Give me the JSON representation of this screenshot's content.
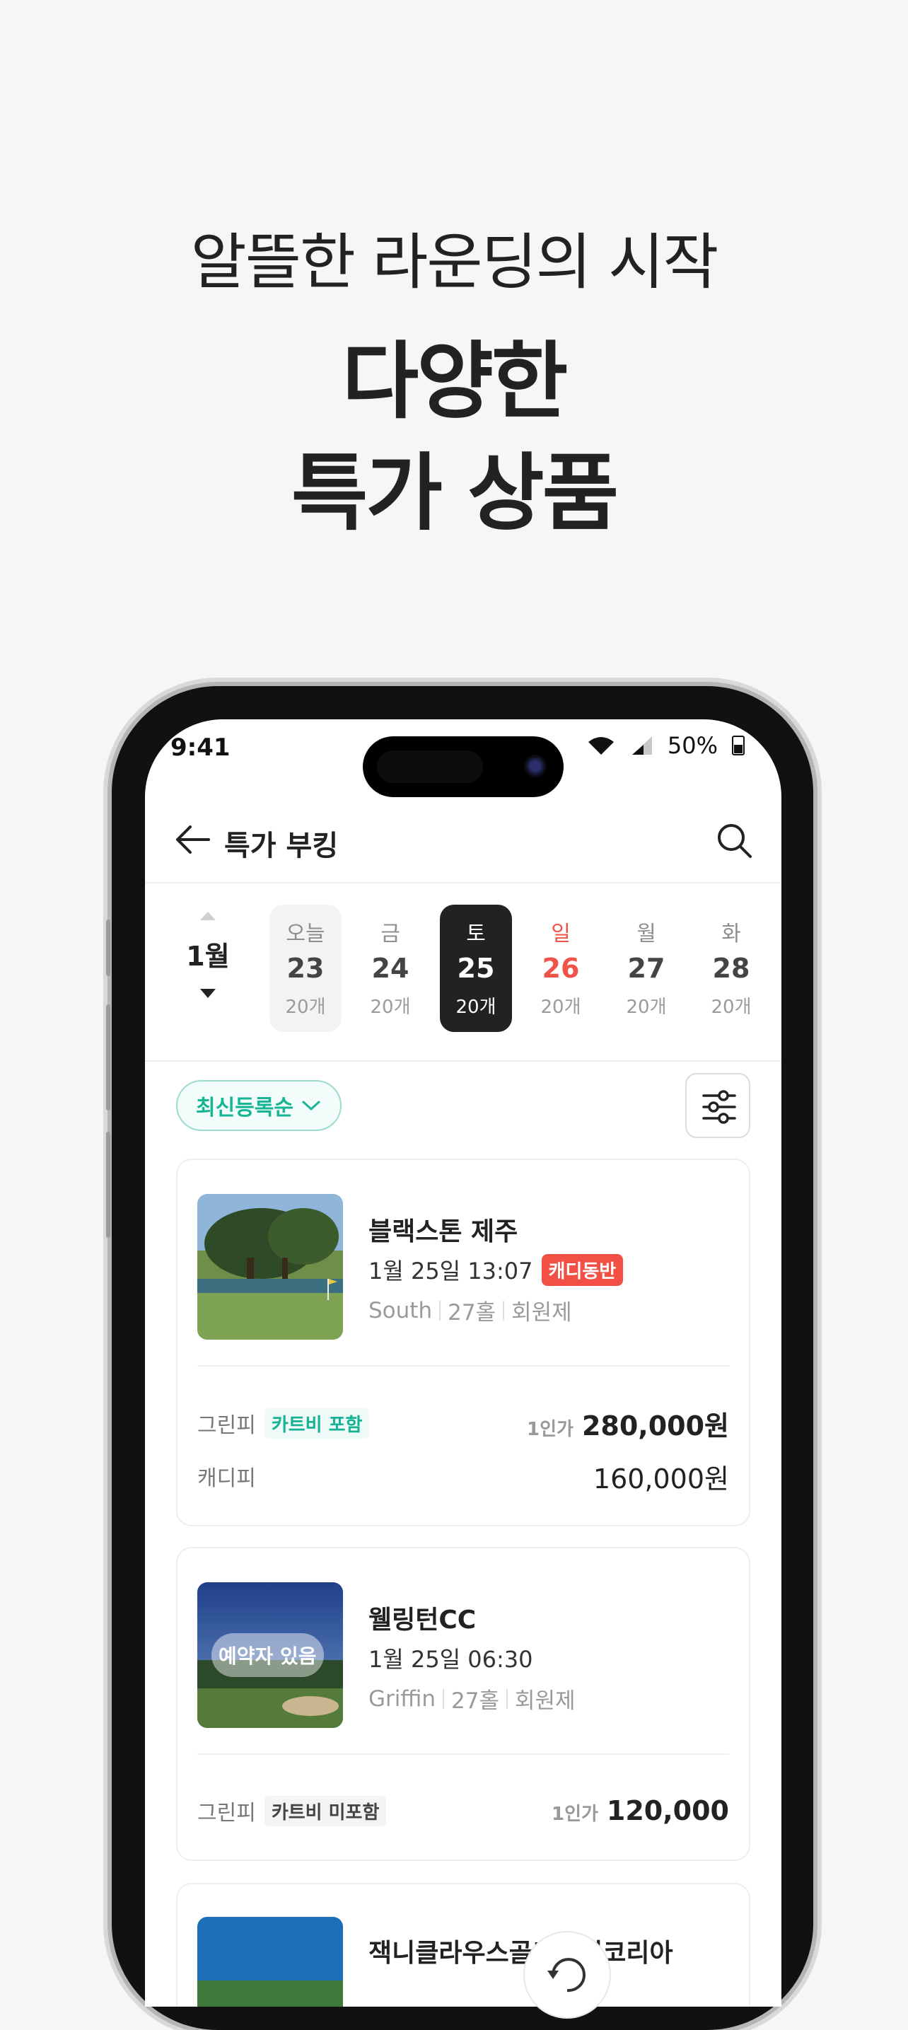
{
  "hero": {
    "subtitle": "알뜰한 라운딩의 시작",
    "title_line1": "다양한",
    "title_line2": "특가 상품"
  },
  "status_bar": {
    "time": "9:41",
    "battery": "50%"
  },
  "header": {
    "title": "특가 부킹",
    "back_icon": "arrow-left-icon",
    "search_icon": "search-icon"
  },
  "date_picker": {
    "month": "1월",
    "days": [
      {
        "dow": "오늘",
        "num": "23",
        "count": "20개",
        "state": "today"
      },
      {
        "dow": "금",
        "num": "24",
        "count": "20개",
        "state": "normal"
      },
      {
        "dow": "토",
        "num": "25",
        "count": "20개",
        "state": "selected"
      },
      {
        "dow": "일",
        "num": "26",
        "count": "20개",
        "state": "sunday"
      },
      {
        "dow": "월",
        "num": "27",
        "count": "20개",
        "state": "normal"
      },
      {
        "dow": "화",
        "num": "28",
        "count": "20개",
        "state": "normal"
      }
    ]
  },
  "sort": {
    "label": "최신등록순",
    "icon": "chevron-down-icon"
  },
  "filter": {
    "icon": "sliders-icon"
  },
  "colors": {
    "accent": "#17b596",
    "sunday": "#f0534a",
    "selected_bg": "#222222",
    "caddy_tag": "#f25045"
  },
  "cards": [
    {
      "name": "블랙스톤 제주",
      "datetime": "1월 25일 13:07",
      "tag": "캐디동반",
      "course": "South",
      "holes": "27홀",
      "membership": "회원제",
      "green_fee_label": "그린피",
      "cart_tag": "카트비 포함",
      "per_person": "1인가",
      "green_fee": "280,000원",
      "caddy_fee_label": "캐디피",
      "caddy_fee": "160,000원"
    },
    {
      "name": "웰링턴CC",
      "datetime": "1월 25일 06:30",
      "badge": "예약자 있음",
      "course": "Griffin",
      "holes": "27홀",
      "membership": "회원제",
      "green_fee_label": "그린피",
      "cart_tag": "카트비 미포함",
      "per_person": "1인가",
      "green_fee": "120,000"
    },
    {
      "name": "잭니클라우스골프클럽코리아"
    }
  ]
}
